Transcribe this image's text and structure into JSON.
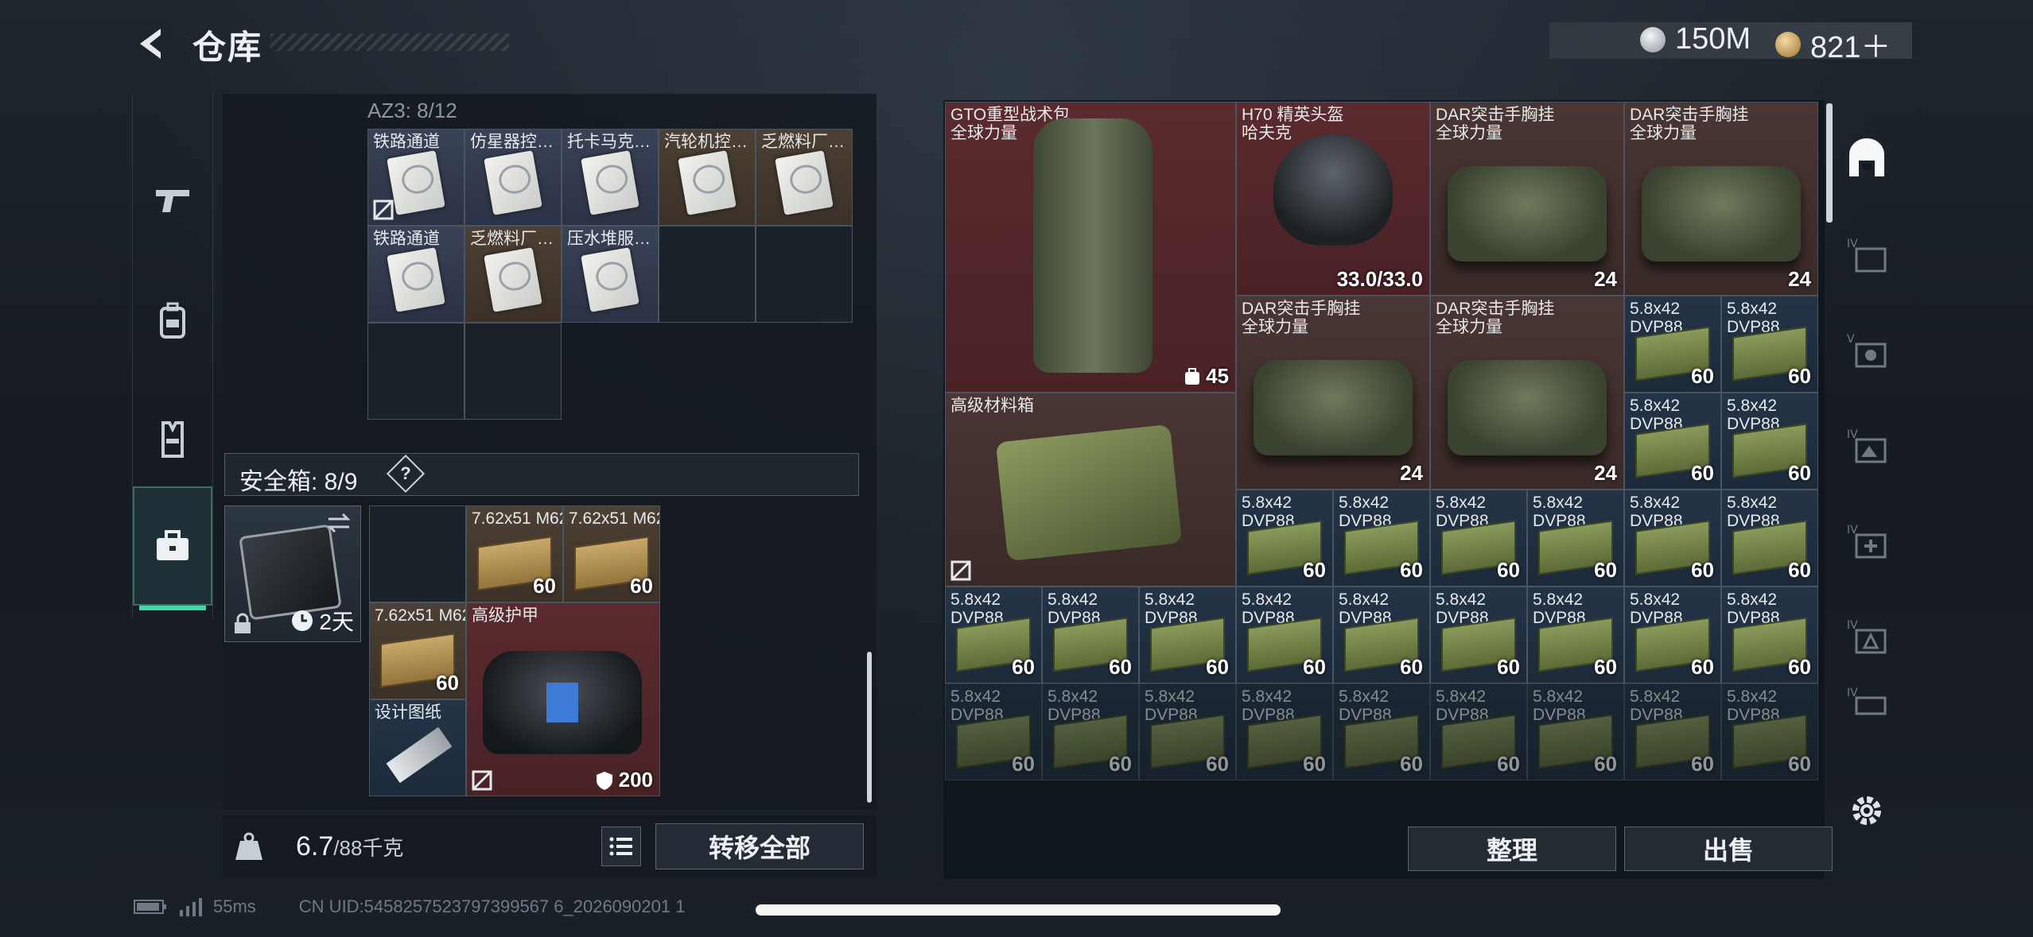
{
  "header": {
    "title": "仓库",
    "currencies": [
      {
        "icon": "silver-coin-icon",
        "value": "150M"
      },
      {
        "icon": "gold-triangle-coin-icon",
        "value": "821＋"
      }
    ]
  },
  "nav": {
    "items": [
      {
        "icon": "pistol-icon"
      },
      {
        "icon": "backpack-icon"
      },
      {
        "icon": "vest-icon"
      },
      {
        "icon": "toolbox-icon",
        "active": true
      }
    ]
  },
  "container": {
    "label": "AZ3: 8/12",
    "items": [
      {
        "label": "铁路通道",
        "color": "blue",
        "nosell": true
      },
      {
        "label": "仿星器控…",
        "color": "blue"
      },
      {
        "label": "托卡马克…",
        "color": "blue"
      },
      {
        "label": "汽轮机控…",
        "color": "brown"
      },
      {
        "label": "乏燃料厂…",
        "color": "brown"
      },
      {
        "label": "铁路通道",
        "color": "blue"
      },
      {
        "label": "乏燃料厂…",
        "color": "brown"
      },
      {
        "label": "压水堆服…",
        "color": "blue"
      }
    ]
  },
  "safebox": {
    "title": "安全箱: 8/9",
    "help": "?",
    "duration": "2天",
    "items": [
      {
        "label": "7.62x51 M62",
        "count": "60"
      },
      {
        "label": "7.62x51 M62",
        "count": "60"
      },
      {
        "label": "7.62x51 M62",
        "count": "60"
      },
      {
        "label": "高级护甲",
        "count": "200"
      },
      {
        "label": "设计图纸"
      }
    ]
  },
  "weight": {
    "value": "6.7",
    "max": "/88千克"
  },
  "buttons": {
    "transfer_all": "转移全部",
    "sort": "整理",
    "sell": "出售"
  },
  "stash": {
    "big_items": [
      {
        "name": "GTO重型战术包",
        "brand": "全球力量",
        "count": "45"
      },
      {
        "name": "H70 精英头盔",
        "brand": "哈夫克",
        "count": "33.0/33.0"
      },
      {
        "name": "DAR突击手胸挂",
        "brand": "全球力量",
        "count": "24"
      },
      {
        "name": "DAR突击手胸挂",
        "brand": "全球力量",
        "count": "24"
      },
      {
        "name": "DAR突击手胸挂",
        "brand": "全球力量",
        "count": "24"
      },
      {
        "name": "DAR突击手胸挂",
        "brand": "全球力量",
        "count": "24"
      },
      {
        "name": "高级材料箱",
        "brand": ""
      }
    ],
    "ammo_label_top": "5.8x42",
    "ammo_label_bottom": "DVP88",
    "ammo_count": "60"
  },
  "status": {
    "ping": "55ms",
    "uid": "CN UID:5458257523797399567 6_2026090201 1"
  }
}
